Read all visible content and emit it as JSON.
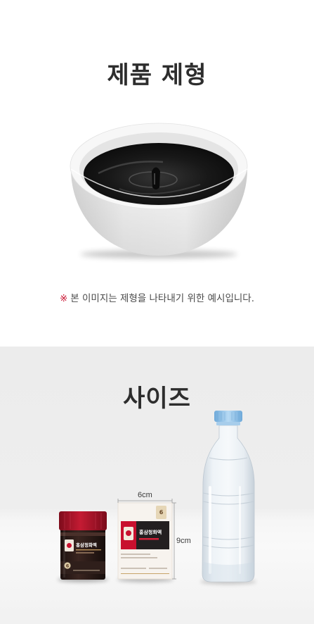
{
  "form_section": {
    "title": "제품 제형",
    "caption_mark": "※",
    "caption_text": "본 이미지는 제형을 나타내기 위한 예시입니다."
  },
  "size_section": {
    "title": "사이즈",
    "box_width_label": "6cm",
    "box_height_label": "9cm"
  },
  "product_labels": {
    "jar_name": "홍삼정화액",
    "jar_badge": "6",
    "box_name": "홍삼청화액",
    "box_badge": "6"
  },
  "colors": {
    "accent_red": "#c8102e",
    "title_text": "#2d2d2d",
    "jar_lid": "#b3162c",
    "bottle_cap": "#8fc2e8"
  },
  "icons": {
    "caption_mark": "reference-mark-icon"
  }
}
